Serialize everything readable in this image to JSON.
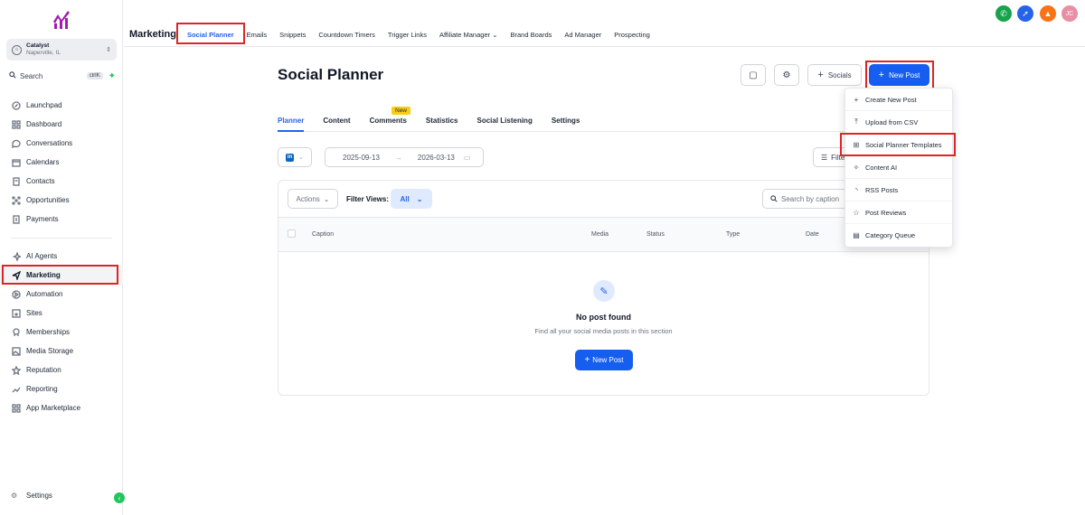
{
  "sidebar": {
    "account": {
      "name": "Catalyst",
      "location": "Naperville, IL"
    },
    "search": {
      "label": "Search",
      "shortcut": "ctrlK"
    },
    "nav_primary": [
      {
        "label": "Launchpad",
        "icon": "rocket-icon"
      },
      {
        "label": "Dashboard",
        "icon": "grid-icon"
      },
      {
        "label": "Conversations",
        "icon": "chat-icon"
      },
      {
        "label": "Calendars",
        "icon": "calendar-icon"
      },
      {
        "label": "Contacts",
        "icon": "contacts-icon"
      },
      {
        "label": "Opportunities",
        "icon": "pipeline-icon"
      },
      {
        "label": "Payments",
        "icon": "payments-icon"
      }
    ],
    "nav_secondary": [
      {
        "label": "AI Agents",
        "icon": "sparkle-icon"
      },
      {
        "label": "Marketing",
        "icon": "send-icon"
      },
      {
        "label": "Automation",
        "icon": "automation-icon"
      },
      {
        "label": "Sites",
        "icon": "sites-icon"
      },
      {
        "label": "Memberships",
        "icon": "membership-icon"
      },
      {
        "label": "Media Storage",
        "icon": "image-icon"
      },
      {
        "label": "Reputation",
        "icon": "star-icon"
      },
      {
        "label": "Reporting",
        "icon": "trend-icon"
      },
      {
        "label": "App Marketplace",
        "icon": "apps-icon"
      }
    ],
    "settings_label": "Settings"
  },
  "topnav": {
    "brand": "Marketing",
    "items": [
      "Social Planner",
      "Emails",
      "Snippets",
      "Countdown Timers",
      "Trigger Links",
      "Affiliate Manager",
      "Brand Boards",
      "Ad Manager",
      "Prospecting"
    ],
    "avatar_initials": "JC",
    "colors": {
      "phone": "#16a34a",
      "rocket": "#2563eb",
      "bell": "#f97316",
      "avatar": "#e88ea5"
    }
  },
  "page": {
    "title": "Social Planner",
    "socials_label": "Socials",
    "new_post_label": "New Post",
    "tabs": [
      "Planner",
      "Content",
      "Comments",
      "Statistics",
      "Social Listening",
      "Settings"
    ],
    "new_badge": "New",
    "date_start": "2025-09-13",
    "date_end": "2026-03-13",
    "filter_label": "Filte",
    "actions_label": "Actions",
    "filter_views_label": "Filter Views:",
    "filter_views_value": "All",
    "search_placeholder": "Search by caption",
    "columns": [
      "Caption",
      "Media",
      "Status",
      "Type",
      "Date"
    ],
    "empty_title": "No post found",
    "empty_sub": "Find all your social media posts in this section",
    "empty_button": "New Post"
  },
  "dropdown": [
    {
      "label": "Create New Post",
      "icon": "plus-icon"
    },
    {
      "label": "Upload from CSV",
      "icon": "upload-icon"
    },
    {
      "label": "Social Planner Templates",
      "icon": "template-icon"
    },
    {
      "label": "Content AI",
      "icon": "magic-wand-icon"
    },
    {
      "label": "RSS Posts",
      "icon": "rss-icon"
    },
    {
      "label": "Post Reviews",
      "icon": "star-icon"
    },
    {
      "label": "Category Queue",
      "icon": "queue-icon"
    }
  ],
  "accent": "#155eef",
  "highlight": "#dc2626"
}
